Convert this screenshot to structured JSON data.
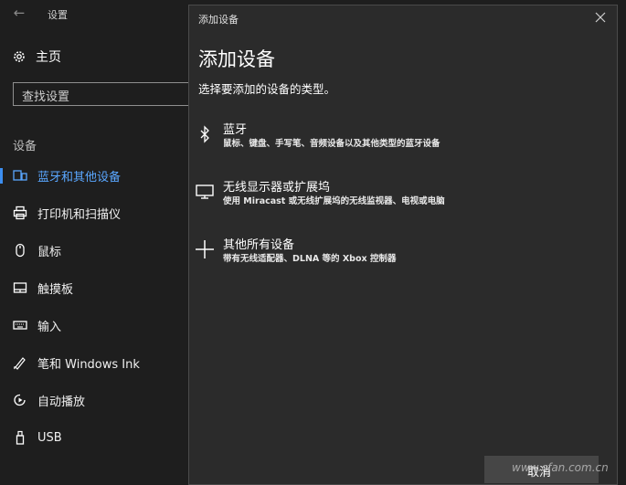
{
  "settings": {
    "back_icon": "back-arrow-icon",
    "title": "设置",
    "home_label": "主页",
    "search_placeholder": "查找设置",
    "section_label": "设备",
    "accent": "#3c8ef0",
    "nav": [
      {
        "label": "蓝牙和其他设备",
        "icon": "bluetooth-devices-icon",
        "active": true
      },
      {
        "label": "打印机和扫描仪",
        "icon": "printer-icon",
        "active": false
      },
      {
        "label": "鼠标",
        "icon": "mouse-icon",
        "active": false
      },
      {
        "label": "触摸板",
        "icon": "touchpad-icon",
        "active": false
      },
      {
        "label": "输入",
        "icon": "keyboard-icon",
        "active": false
      },
      {
        "label": "笔和 Windows Ink",
        "icon": "pen-icon",
        "active": false
      },
      {
        "label": "自动播放",
        "icon": "autoplay-icon",
        "active": false
      },
      {
        "label": "USB",
        "icon": "usb-icon",
        "active": false
      }
    ]
  },
  "dialog": {
    "window_title": "添加设备",
    "heading": "添加设备",
    "subtitle": "选择要添加的设备的类型。",
    "options": [
      {
        "title": "蓝牙",
        "desc": "鼠标、键盘、手写笔、音频设备以及其他类型的蓝牙设备",
        "icon": "bluetooth-icon"
      },
      {
        "title": "无线显示器或扩展坞",
        "desc": "使用 Miracast 或无线扩展坞的无线监视器、电视或电脑",
        "icon": "monitor-icon"
      },
      {
        "title": "其他所有设备",
        "desc": "带有无线适配器、DLNA 等的 Xbox 控制器",
        "icon": "plus-icon"
      }
    ],
    "cancel_label": "取消"
  },
  "watermark": "www.cfan.com.cn"
}
